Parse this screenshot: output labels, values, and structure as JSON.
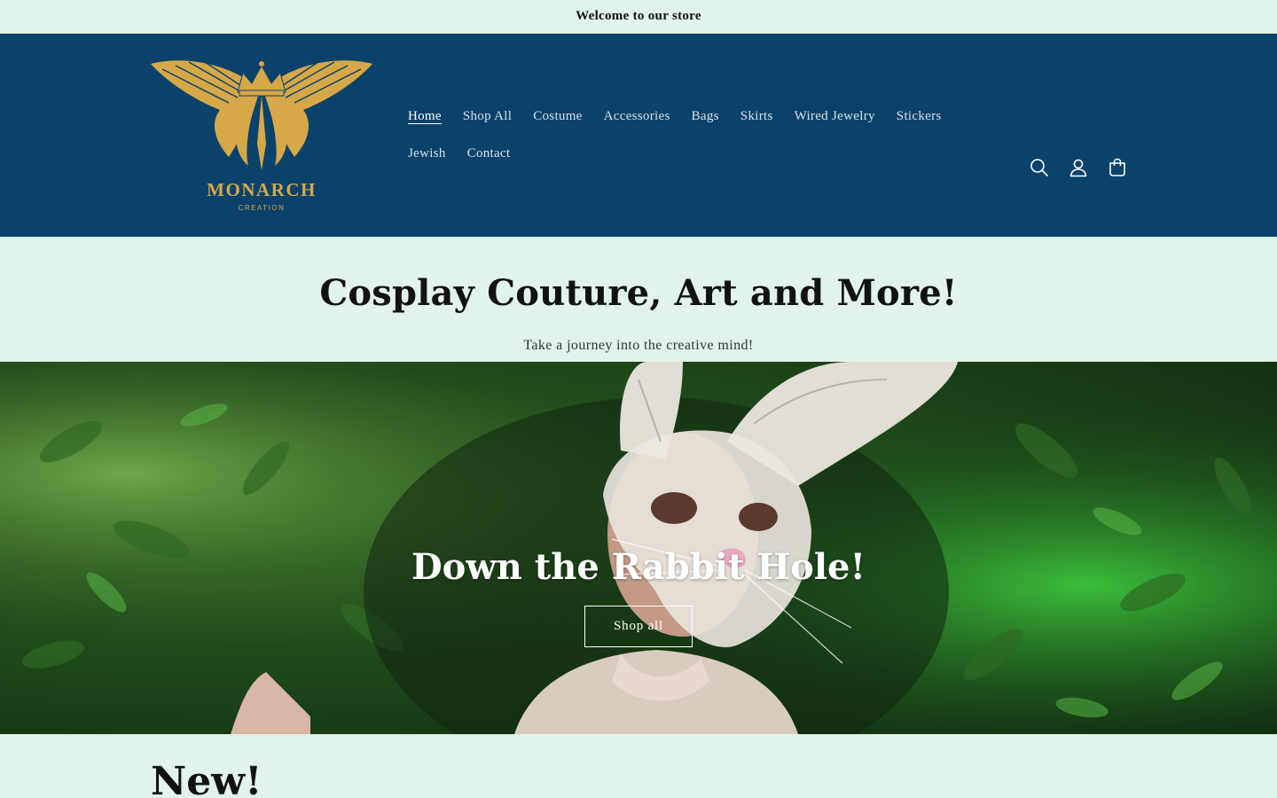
{
  "announcement": {
    "text": "Welcome to our store"
  },
  "brand": {
    "name": "MONARCH",
    "tagline": "CREATION",
    "logo_color": "#d6a848",
    "header_color": "#0b426b"
  },
  "nav": {
    "items": [
      {
        "label": "Home",
        "active": true
      },
      {
        "label": "Shop All"
      },
      {
        "label": "Costume"
      },
      {
        "label": "Accessories"
      },
      {
        "label": "Bags"
      },
      {
        "label": "Skirts"
      },
      {
        "label": "Wired Jewelry"
      },
      {
        "label": "Stickers"
      },
      {
        "label": "Jewish"
      },
      {
        "label": "Contact"
      }
    ]
  },
  "header_icons": [
    "search-icon",
    "account-icon",
    "cart-icon"
  ],
  "intro": {
    "title": "Cosplay Couture, Art and More!",
    "subtitle": "Take a journey into the creative mind!"
  },
  "hero": {
    "title": "Down the Rabbit Hole!",
    "button_label": "Shop all"
  },
  "new_section": {
    "title": "New!"
  },
  "colors": {
    "page_background": "#e1f3ea",
    "text": "#121212"
  }
}
